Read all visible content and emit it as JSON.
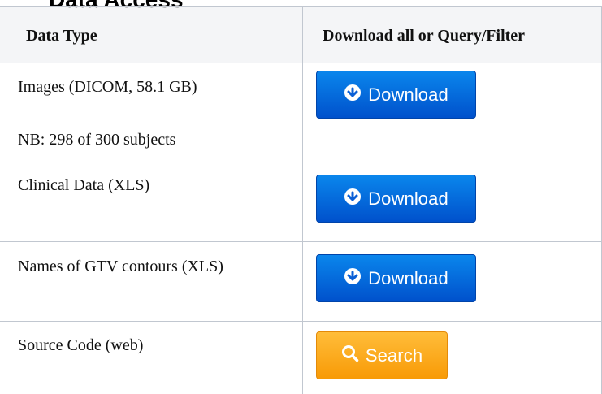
{
  "page": {
    "heading": "Data Access"
  },
  "table": {
    "headers": {
      "data_type": "Data Type",
      "download": "Download all or Query/Filter"
    },
    "rows": [
      {
        "data_type": "Images (DICOM, 58.1 GB)",
        "note": "NB: 298 of 300 subjects",
        "button_label": "Download",
        "button_icon": "download-circle-icon",
        "button_color": "#0a6fe0"
      },
      {
        "data_type": "Clinical Data (XLS)",
        "button_label": "Download",
        "button_icon": "download-circle-icon",
        "button_color": "#0a6fe0"
      },
      {
        "data_type": "Names of GTV contours (XLS)",
        "button_label": "Download",
        "button_icon": "download-circle-icon",
        "button_color": "#0a6fe0"
      },
      {
        "data_type": "Source Code (web)",
        "button_label": "Search",
        "button_icon": "search-icon",
        "button_color": "#fbab1c"
      }
    ]
  },
  "colors": {
    "border": "#c1c7d0",
    "header_bg": "#f4f5f7",
    "download_button": "#0a6fe0",
    "search_button": "#fbab1c"
  }
}
